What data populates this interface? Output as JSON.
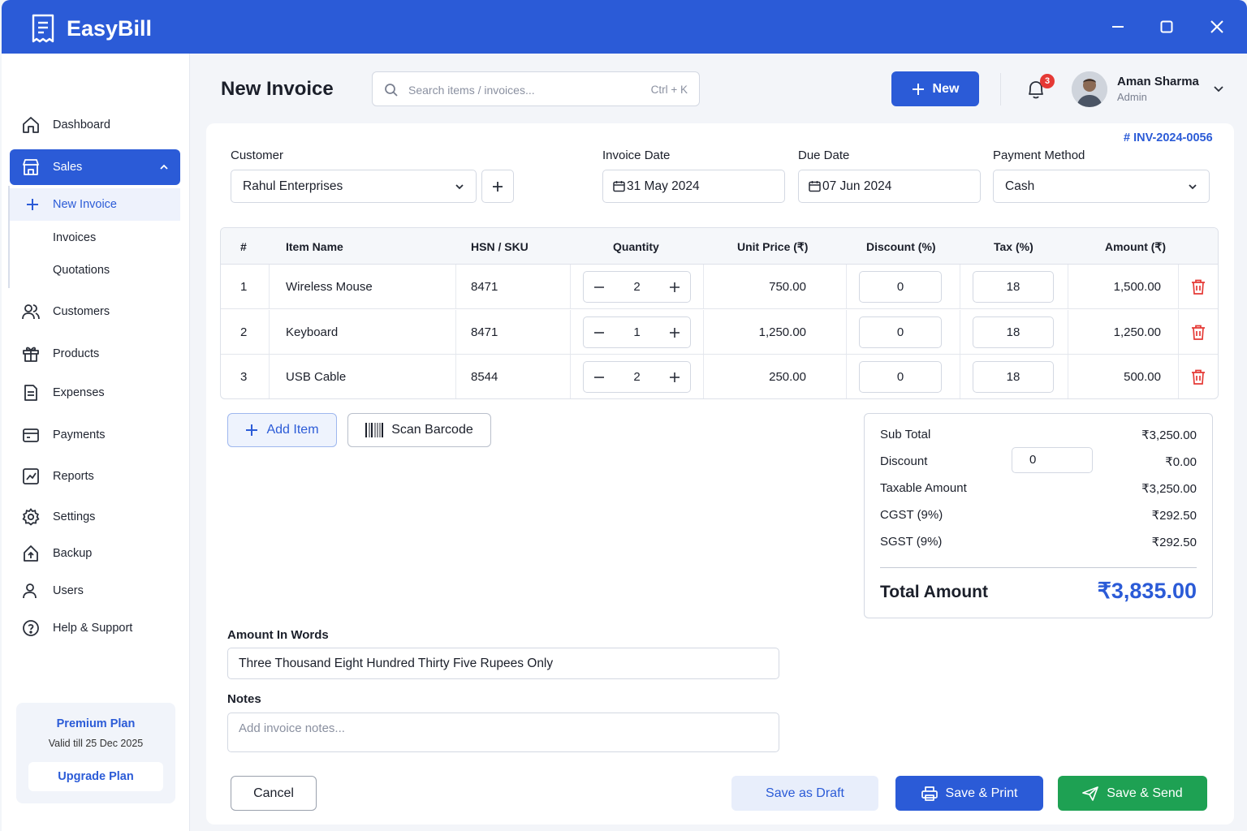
{
  "app": {
    "title": "EasyBill"
  },
  "colors": {
    "primary": "#2b5bd7",
    "success": "#1ea153",
    "danger": "#e53935"
  },
  "sidebar": {
    "items": [
      {
        "label": "Dashboard",
        "icon": "home-icon"
      },
      {
        "label": "Sales",
        "icon": "store-icon",
        "active": true
      },
      {
        "label": "Customers",
        "icon": "users-icon"
      },
      {
        "label": "Products",
        "icon": "box-icon"
      },
      {
        "label": "Expenses",
        "icon": "receipt-icon"
      },
      {
        "label": "Payments",
        "icon": "wallet-icon"
      },
      {
        "label": "Reports",
        "icon": "chart-icon"
      },
      {
        "label": "Settings",
        "icon": "gear-icon"
      },
      {
        "label": "Backup",
        "icon": "cloud-upload-icon"
      },
      {
        "label": "Users",
        "icon": "user-icon"
      },
      {
        "label": "Help & Support",
        "icon": "help-icon"
      }
    ],
    "sales_sub": [
      {
        "label": "New Invoice",
        "current": true
      },
      {
        "label": "Invoices"
      },
      {
        "label": "Quotations"
      }
    ],
    "plan": {
      "name": "Premium Plan",
      "valid": "Valid till 25 Dec 2025",
      "upgrade": "Upgrade Plan"
    }
  },
  "header": {
    "title": "New Invoice",
    "search_placeholder": "Search items / invoices...",
    "search_shortcut": "Ctrl + K",
    "new_button": "New",
    "notification_count": "3",
    "user_name": "Aman Sharma",
    "user_role": "Admin"
  },
  "invoice": {
    "number": "# INV-2024-0056",
    "customer_label": "Customer",
    "customer": "Rahul Enterprises",
    "invoice_date_label": "Invoice Date",
    "invoice_date": "31 May 2024",
    "due_date_label": "Due Date",
    "due_date": "07 Jun 2024",
    "payment_method_label": "Payment Method",
    "payment_method": "Cash"
  },
  "items_table": {
    "headers": [
      "#",
      "Item Name",
      "HSN / SKU",
      "Quantity",
      "Unit Price (₹)",
      "Discount (%)",
      "Tax (%)",
      "Amount (₹)"
    ],
    "rows": [
      {
        "no": "1",
        "name": "Wireless Mouse",
        "hsn": "8471",
        "qty": "2",
        "price": "750.00",
        "discount": "0",
        "tax": "18",
        "amount": "1,500.00"
      },
      {
        "no": "2",
        "name": "Keyboard",
        "hsn": "8471",
        "qty": "1",
        "price": "1,250.00",
        "discount": "0",
        "tax": "18",
        "amount": "1,250.00"
      },
      {
        "no": "3",
        "name": "USB Cable",
        "hsn": "8544",
        "qty": "2",
        "price": "250.00",
        "discount": "0",
        "tax": "18",
        "amount": "500.00"
      }
    ]
  },
  "actions": {
    "add_item": "Add Item",
    "scan_barcode": "Scan Barcode"
  },
  "summary": {
    "subtotal_label": "Sub Total",
    "subtotal": "₹3,250.00",
    "discount_label": "Discount",
    "discount_input": "0",
    "discount": "₹0.00",
    "taxable_label": "Taxable Amount",
    "taxable": "₹3,250.00",
    "cgst_label": "CGST (9%)",
    "cgst": "₹292.50",
    "sgst_label": "SGST (9%)",
    "sgst": "₹292.50",
    "total_label": "Total Amount",
    "total": "₹3,835.00"
  },
  "words": {
    "label": "Amount In Words",
    "value": "Three Thousand Eight Hundred Thirty Five Rupees Only"
  },
  "notes": {
    "label": "Notes",
    "placeholder": "Add invoice notes..."
  },
  "footer": {
    "cancel": "Cancel",
    "draft": "Save as Draft",
    "print": "Save & Print",
    "send": "Save & Send"
  }
}
